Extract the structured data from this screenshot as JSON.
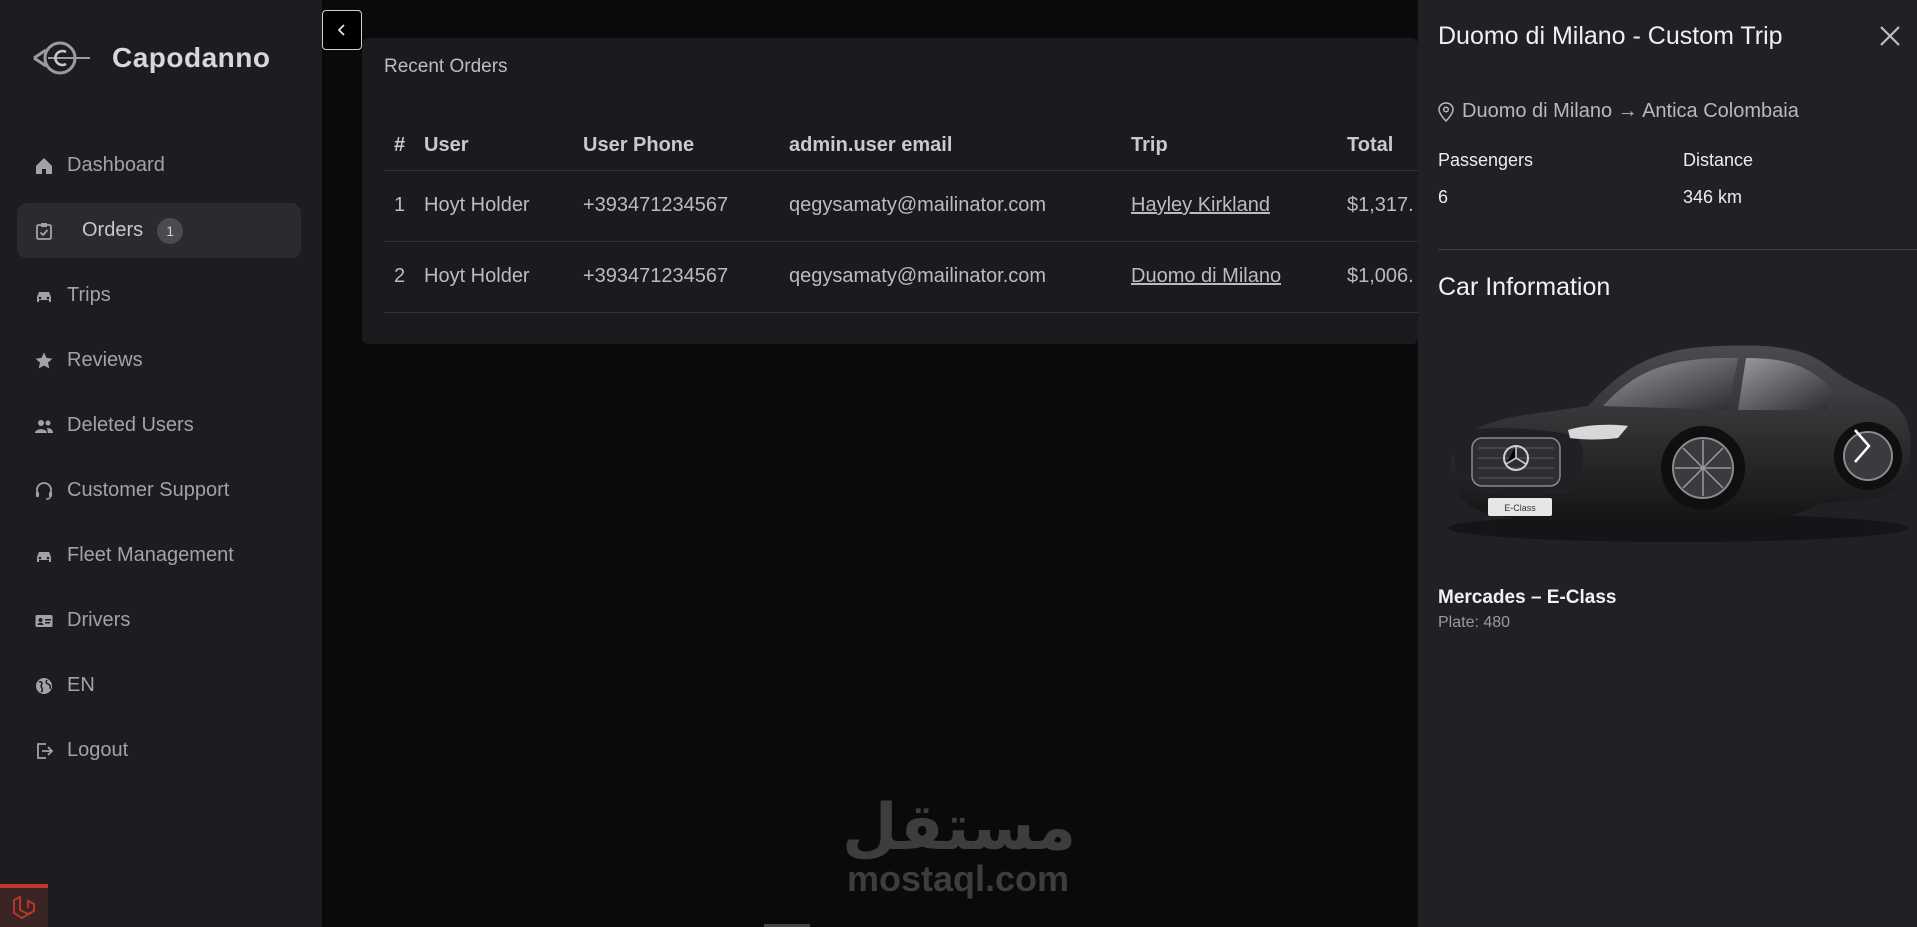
{
  "app": {
    "name": "Capodanno"
  },
  "sidebar": {
    "items": [
      {
        "label": "Dashboard",
        "icon": "home-icon"
      },
      {
        "label": "Orders",
        "icon": "clipboard-check-icon",
        "badge": "1",
        "active": true
      },
      {
        "label": "Trips",
        "icon": "car-icon"
      },
      {
        "label": "Reviews",
        "icon": "star-icon"
      },
      {
        "label": "Deleted Users",
        "icon": "users-icon"
      },
      {
        "label": "Customer Support",
        "icon": "headset-icon"
      },
      {
        "label": "Fleet Management",
        "icon": "car-icon"
      },
      {
        "label": "Drivers",
        "icon": "id-card-icon"
      },
      {
        "label": "EN",
        "icon": "globe-icon"
      },
      {
        "label": "Logout",
        "icon": "logout-icon"
      }
    ]
  },
  "orders": {
    "title": "Recent Orders",
    "columns": [
      "#",
      "User",
      "User Phone",
      "admin.user email",
      "Trip",
      "Total"
    ],
    "rows": [
      {
        "num": "1",
        "user": "Hoyt Holder",
        "phone": "+393471234567",
        "email": "qegysamaty@mailinator.com",
        "trip": "Hayley Kirkland",
        "total": "$1,317."
      },
      {
        "num": "2",
        "user": "Hoyt Holder",
        "phone": "+393471234567",
        "email": "qegysamaty@mailinator.com",
        "trip": "Duomo di Milano",
        "total": "$1,006."
      }
    ]
  },
  "drawer": {
    "title": "Duomo di Milano - Custom Trip",
    "route": "Duomo di Milano → Antica Colombaia",
    "passengers_label": "Passengers",
    "passengers_value": "6",
    "distance_label": "Distance",
    "distance_value": "346 km",
    "car_section_title": "Car Information",
    "car_name": "Mercades – E-Class",
    "car_plate": "Plate: 480",
    "car_badge": "E-Class"
  },
  "watermark": {
    "arabic": "مستقل",
    "latin": "mostaql.com"
  },
  "colors": {
    "sidebar": "#1c1d20",
    "drawer": "#202125",
    "card": "#1a1b1e",
    "accent": "#c0392b"
  }
}
